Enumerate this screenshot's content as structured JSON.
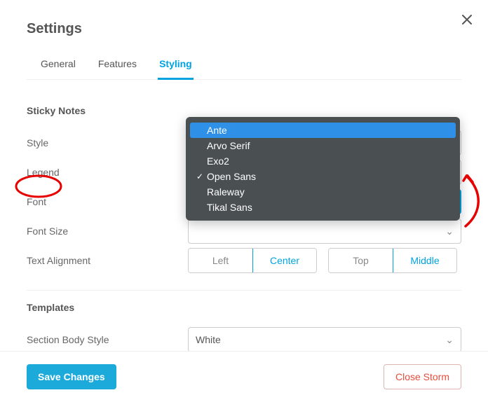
{
  "header": {
    "title": "Settings"
  },
  "tabs": {
    "general": "General",
    "features": "Features",
    "styling": "Styling"
  },
  "sticky_notes": {
    "section": "Sticky Notes",
    "style_label": "Style",
    "legend_label": "Legend",
    "font_label": "Font",
    "font_size_label": "Font Size",
    "text_align_label": "Text Alignment",
    "align_left": "Left",
    "align_center": "Center",
    "align_top": "Top",
    "align_middle": "Middle"
  },
  "templates": {
    "section": "Templates",
    "body_style_label": "Section Body Style",
    "body_style_value": "White"
  },
  "dropdown": {
    "items": [
      {
        "label": "Ante",
        "selected": false,
        "highlight": true
      },
      {
        "label": "Arvo Serif",
        "selected": false,
        "highlight": false
      },
      {
        "label": "Exo2",
        "selected": false,
        "highlight": false
      },
      {
        "label": "Open Sans",
        "selected": true,
        "highlight": false
      },
      {
        "label": "Raleway",
        "selected": false,
        "highlight": false
      },
      {
        "label": "Tikal Sans",
        "selected": false,
        "highlight": false
      }
    ]
  },
  "footer": {
    "save": "Save Changes",
    "close": "Close Storm"
  }
}
